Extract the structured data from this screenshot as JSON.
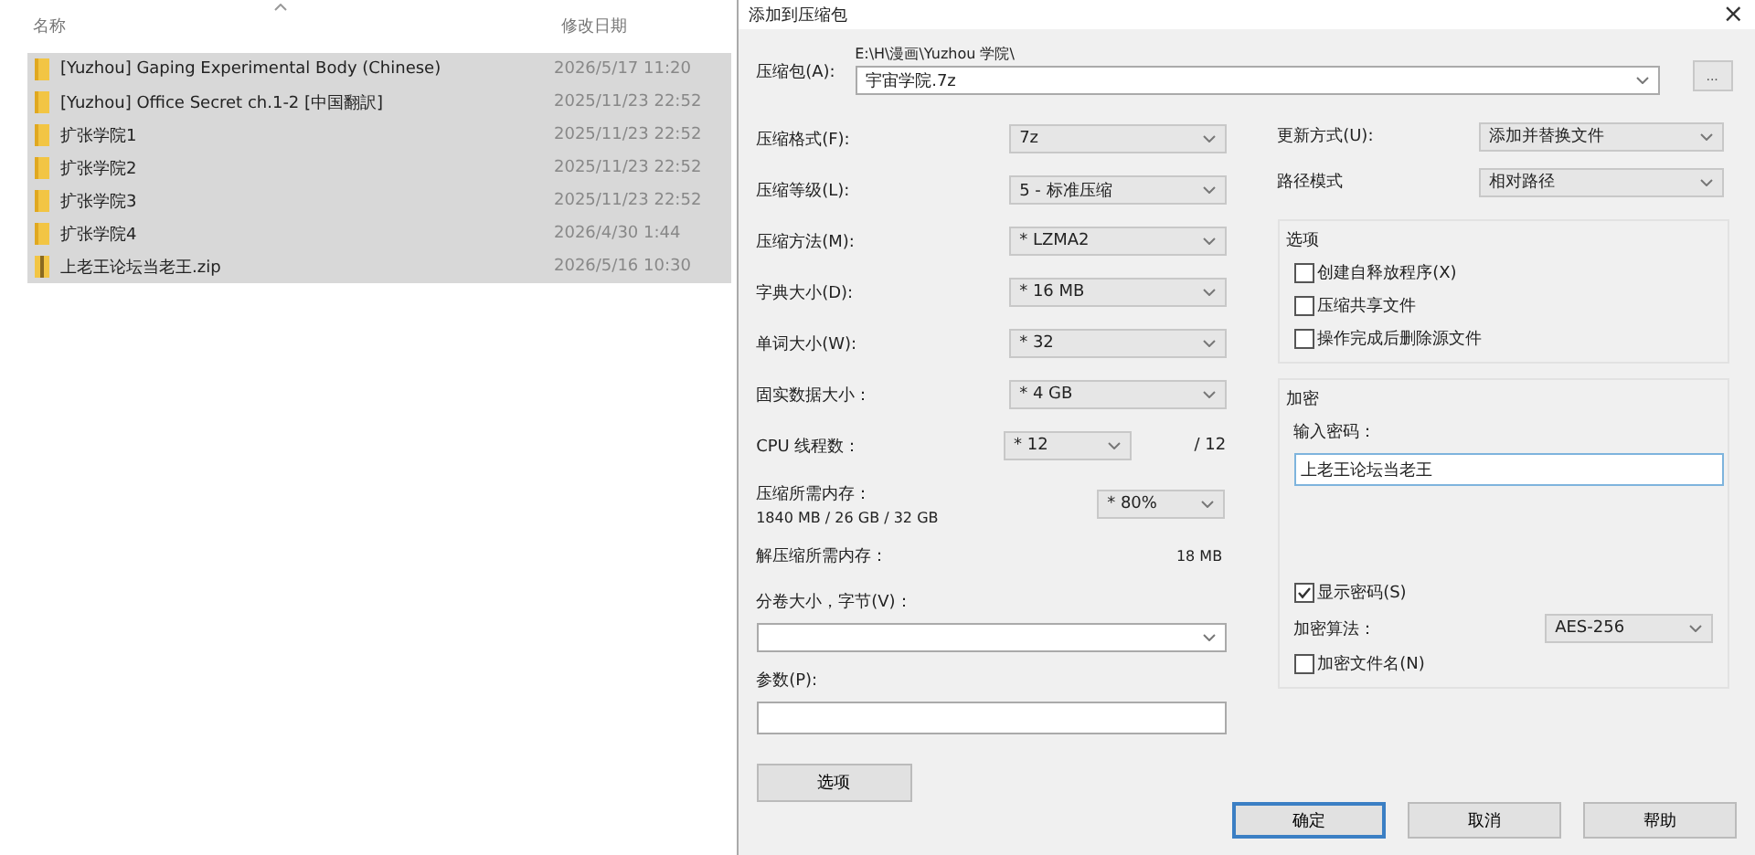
{
  "explorer": {
    "columns": [
      "名称",
      "修改日期"
    ],
    "files": [
      {
        "name": "[Yuzhou] Gaping Experimental Body (Chinese)",
        "modified": "2026/5/17 11:20",
        "kind": "folder",
        "selected": true
      },
      {
        "name": "[Yuzhou] Office Secret ch.1-2 [中国翻訳]",
        "modified": "2025/11/23 22:52",
        "kind": "folder",
        "selected": true
      },
      {
        "name": "扩张学院1",
        "modified": "2025/11/23 22:52",
        "kind": "folder",
        "selected": true
      },
      {
        "name": "扩张学院2",
        "modified": "2025/11/23 22:52",
        "kind": "folder",
        "selected": true
      },
      {
        "name": "扩张学院3",
        "modified": "2025/11/23 22:52",
        "kind": "folder",
        "selected": true
      },
      {
        "name": "扩张学院4",
        "modified": "2026/4/30 1:44",
        "kind": "folder",
        "selected": true
      },
      {
        "name": "上老王论坛当老王.zip",
        "modified": "2026/5/16 10:30",
        "kind": "zip",
        "selected": true
      }
    ]
  },
  "dialog": {
    "title": "添加到压缩包",
    "close": "×",
    "archive": {
      "label": "压缩包(A):",
      "path": "E:\\H\\漫画\\Yuzhou 学院\\",
      "value": "宇宙学院.7z",
      "browse": "..."
    },
    "settings": [
      {
        "kind": "combo",
        "label": "压缩格式(F):",
        "value": "7z"
      },
      {
        "kind": "combo",
        "label": "压缩等级(L):",
        "value": "5 - 标准压缩"
      },
      {
        "kind": "combo",
        "label": "压缩方法(M):",
        "value": "* LZMA2"
      },
      {
        "kind": "combo",
        "label": "字典大小(D):",
        "value": "* 16 MB"
      },
      {
        "kind": "combo",
        "label": "单词大小(W):",
        "value": "* 32"
      },
      {
        "kind": "combo",
        "label": "固实数据大小：",
        "value": "* 4 GB"
      },
      {
        "kind": "cpu",
        "label": "CPU 线程数：",
        "value": "* 12",
        "suffix": "/ 12"
      },
      {
        "kind": "memory",
        "label": "压缩所需内存：",
        "detail": "1840 MB / 26 GB / 32 GB",
        "value": "* 80%"
      },
      {
        "kind": "readout",
        "label": "解压缩所需内存：",
        "value": "18 MB"
      }
    ],
    "volume": {
      "label": "分卷大小，字节(V)："
    },
    "parameters": {
      "label": "参数(P):"
    },
    "options_button": "选项",
    "update": {
      "label": "更新方式(U):",
      "value": "添加并替换文件"
    },
    "path_mode": {
      "label": "路径模式",
      "value": "相对路径"
    },
    "options": {
      "title": "选项",
      "items": [
        {
          "label": "创建自释放程序(X)",
          "checked": false
        },
        {
          "label": "压缩共享文件",
          "checked": false
        },
        {
          "label": "操作完成后删除源文件",
          "checked": false
        }
      ]
    },
    "encryption": {
      "title": "加密",
      "password_label": "输入密码：",
      "password": "上老王论坛当老王",
      "show_password": {
        "label": "显示密码(S)",
        "checked": true
      },
      "method": {
        "label": "加密算法：",
        "value": "AES-256"
      },
      "encrypt_names": {
        "label": "加密文件名(N)",
        "checked": false
      }
    },
    "buttons": [
      {
        "label": "确定",
        "focused": true
      },
      {
        "label": "取消",
        "focused": false
      },
      {
        "label": "帮助",
        "focused": false
      }
    ]
  }
}
